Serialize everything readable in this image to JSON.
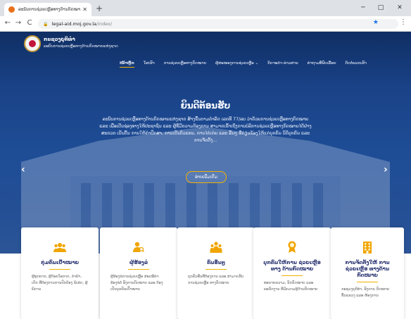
{
  "browser": {
    "tab_title": "ລະບົບການຊ່ວຍເຫຼືອທາງດ້ານກົດໝາຍ",
    "tab_close": "✕",
    "new_tab": "+",
    "controls": {
      "minimize": "─",
      "maximize": "□",
      "close": "✕"
    },
    "url_host": "legal-aid.moj.gov.la",
    "url_path": "/index/",
    "nav_back": "←",
    "nav_forward": "→",
    "nav_reload": "C",
    "lock": "🔒",
    "bookmark_star": "★",
    "menu": "⋮"
  },
  "site": {
    "org_name": "ກະຊວງຍຸຕິທຳ",
    "system_name": "ລະບົບການຊ່ວຍເຫຼືອທາງດ້ານກົດໝາຍແຫ່ງຊາດ",
    "menu": [
      {
        "label": "ໜ້າຫຼັກ",
        "active": true
      },
      {
        "label": "ໃຜເຮົາ",
        "active": false
      },
      {
        "label": "ການຊ່ວຍເຫຼືອທາງກົດໝາຍ",
        "active": false
      },
      {
        "label": "ຜູ້ສະໜອງການຊ່ວຍເຫຼືອ ⌄",
        "active": false
      },
      {
        "label": "ກິດຈະກຳ-ຂ່າວສານ",
        "active": false
      },
      {
        "label": "ຄຳຖາມທີ່ພົບເລື້ອຍ",
        "active": false
      },
      {
        "label": "ຕິດຕໍ່ພວກເຮົາ",
        "active": false
      }
    ]
  },
  "hero": {
    "title": "ຍິນດີຕ້ອນຮັບ",
    "text": "ລະບົບການຊ່ວຍເຫຼືອທາງດ້ານກົດໝາຍແຫ່ງຊາດ ສ້າງຂຶ້ນຕາມດຳລັດ ເລກທີ 77/ລບ ວ່າດ້ວຍການຊ່ວຍເຫຼືອທາງກົດໝາຍ ແລະ ເພື່ອເປັນຊ່ອງທາງໃຫ້ປະຊາຊົນ ແລະ ຜູ້ທີ່ມີຄວາມຕ້ອງການ ສາມາດເຂົ້າເຖິງການບໍລິການຊ່ວຍເຫຼືອທາງກົດໝາຍໄດ້ຢ່າງສະດວກ ເປັນຕົ້ນ ການໃຫ້ຄຳປຶກສາ, ການເປັນຕົວແທນ, ການໄກ່ເກ່ຍ ແລະ ອື່ນໆ ທີ່ກ່ຽວຂ້ອງໃຫ້ແກ່ບຸກຄົນ ນິຕິບຸກຄົນ ແລະ ການຈັດຕັ້ງ...",
    "button": "ອ່ານເພີ່ມເຕີມ",
    "prev": "‹",
    "next": "›"
  },
  "cards": [
    {
      "title": "ກຸ່ມຄົນເປົ້າໝາຍ",
      "text": "ຜູ້ທຸກຍາກ, ຜູ້ດ້ອຍໂອກາດ, ກຳພ້າ, ເດັກ ທີ່ຕ້ອງການການປົກປ້ອງ ພິເສດ, ຜູ້ພິການ",
      "icon": "people-group-icon"
    },
    {
      "title": "ຜູ້ຮ້ອງຂໍ",
      "text": "ຜູ້ຮ້ອງຂໍການຊ່ວຍເຫຼືອ ສະເໜີຄຳຮ້ອງຂໍຕໍ່ ອົງການກົດໝາຍ ແລະ ຕ້ອງ ເປັນບຸກຄົນເປົ້າໝາຍ",
      "icon": "person-search-icon"
    },
    {
      "title": "ຄົນອື່ນໆ",
      "text": "ບຸກຄົນອື່ນທີ່ຕ້ອງການ ແລະ ສາມາດຮັບ ການຊ່ວຍເຫຼືອ ທາງກົດໝາຍ",
      "icon": "people-icon"
    },
    {
      "title": "ບຸກຄົນໃຫ້ການ ຊ່ວຍເຫຼືອທາງ ດ້ານກົດໝາຍ",
      "text": "ທະນາຍຄວາມ, ນັກກົດໝາຍ ແລະ ພະນັກງານ ທີ່ມີຄວາມຮູ້ດ້ານກົດໝາຍ",
      "icon": "award-icon"
    },
    {
      "title": "ການຈັດຕັ້ງໃຫ້ ການຊ່ວຍເຫຼືອ ທາງດ້ານກົດໝາຍ",
      "text": "ກະຊວງຍຸຕິທຳ, ອົງການ ກົດໝາຍຂັ້ນແຂວງ ແລະ ຫ້ອງການ",
      "icon": "building-icon"
    }
  ]
}
